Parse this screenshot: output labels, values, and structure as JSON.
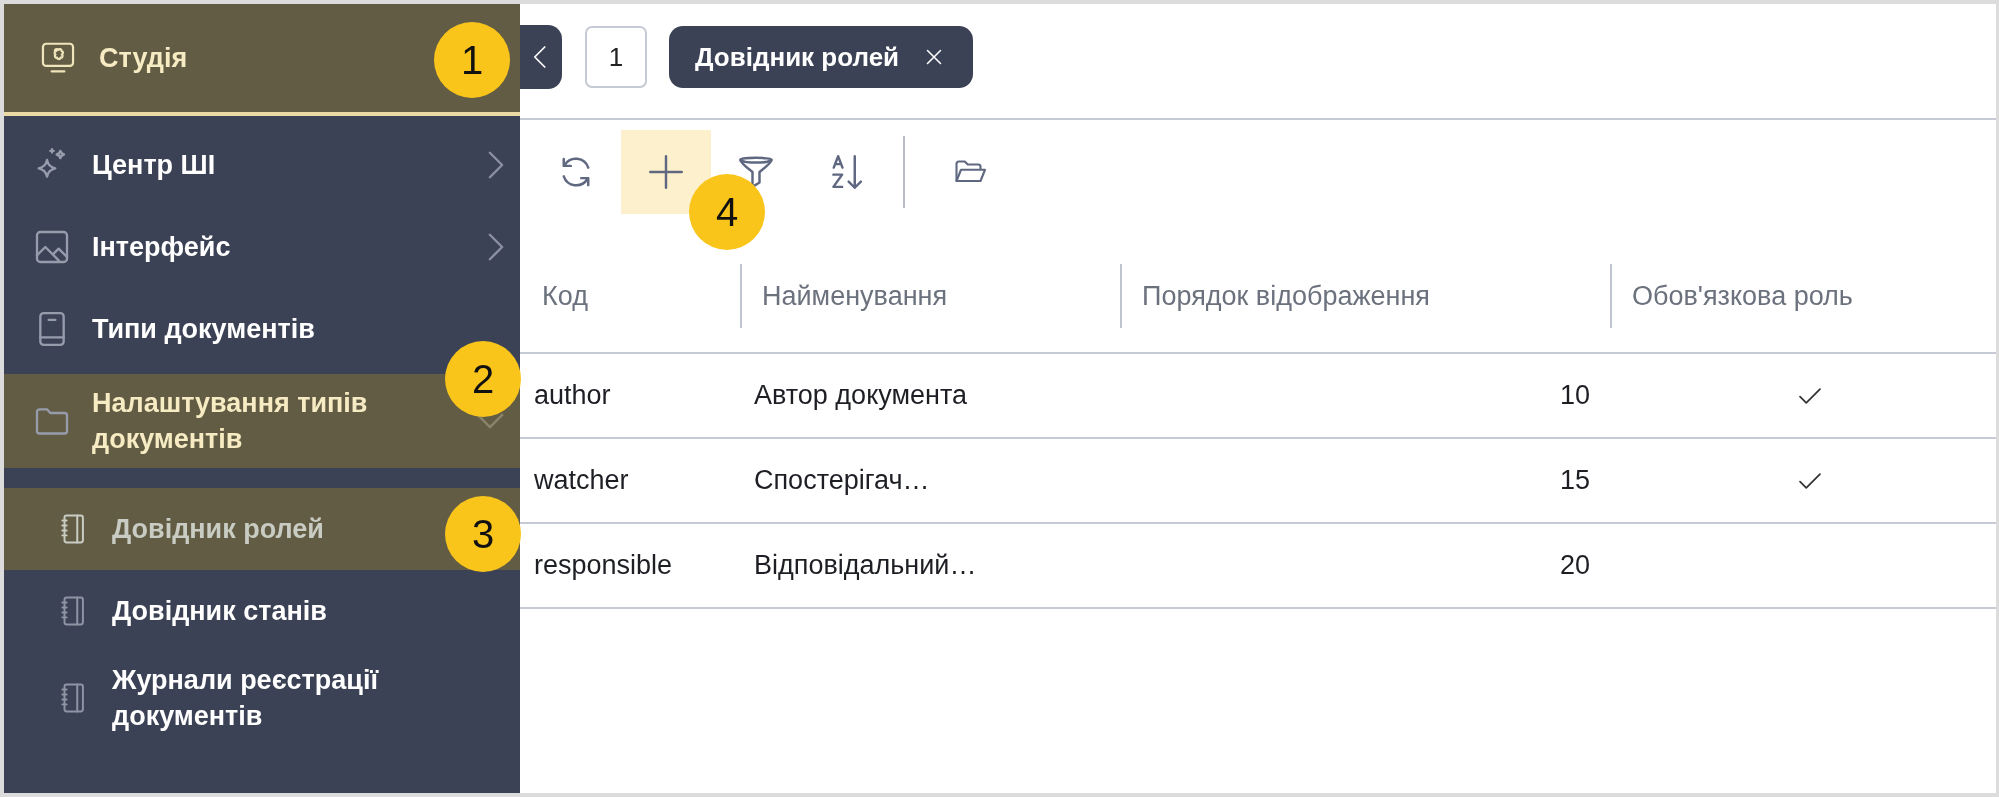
{
  "sidebar": {
    "header": {
      "label": "Студія",
      "selected": true
    },
    "items": [
      {
        "label": "Центр ШІ",
        "kind": "group",
        "expanded": false,
        "selected": false
      },
      {
        "label": "Інтерфейс",
        "kind": "group",
        "expanded": false,
        "selected": false
      },
      {
        "label": "Типи документів",
        "kind": "link",
        "selected": false
      },
      {
        "label": "Налаштування типів документів",
        "kind": "group",
        "expanded": true,
        "selected": true,
        "children": [
          {
            "label": "Довідник ролей",
            "selected": true
          },
          {
            "label": "Довідник станів",
            "selected": false
          },
          {
            "label": "Журнали реєстрації документів",
            "selected": false
          }
        ]
      }
    ]
  },
  "top_bar": {
    "page_counter": "1",
    "tabs": [
      {
        "label": "Довідник ролей",
        "selected": true
      }
    ]
  },
  "toolbar": [
    {
      "kind": "refresh",
      "highlighted": false
    },
    {
      "kind": "add",
      "highlighted": true
    },
    {
      "kind": "filter",
      "highlighted": false
    },
    {
      "kind": "sort",
      "highlighted": false
    },
    {
      "kind": "separator"
    },
    {
      "kind": "folder",
      "highlighted": false
    }
  ],
  "table": {
    "columns": [
      "Код",
      "Найменування",
      "Порядок відображення",
      "Обов'язкова роль"
    ],
    "rows": [
      {
        "code": "author",
        "name": "Автор документа",
        "order": "10",
        "required": true
      },
      {
        "code": "watcher",
        "name": "Спостерігач…",
        "order": "15",
        "required": true
      },
      {
        "code": "responsible",
        "name": "Відповідальний…",
        "order": "20",
        "required": false
      }
    ]
  },
  "callouts": [
    {
      "label": "1"
    },
    {
      "label": "2"
    },
    {
      "label": "3"
    },
    {
      "label": "4"
    }
  ]
}
